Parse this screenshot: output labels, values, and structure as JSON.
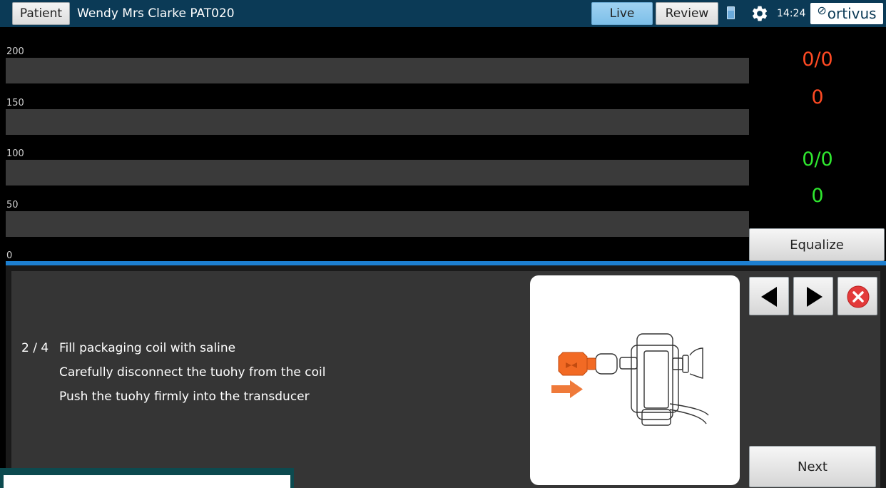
{
  "header": {
    "patient_button": "Patient",
    "patient_name": "Wendy Mrs Clarke PAT020",
    "live_button": "Live",
    "review_button": "Review",
    "clock": "14:24",
    "logo_text": "ortivus",
    "icons": [
      "battery-icon",
      "gear-icon"
    ]
  },
  "chart": {
    "y_ticks": [
      "200",
      "150",
      "100",
      "50",
      "0"
    ]
  },
  "readings": {
    "red_pressure": "0/0",
    "red_value": "0",
    "green_pressure": "0/0",
    "green_value": "0",
    "colors": {
      "red": "#ff4a23",
      "green": "#2fe82f"
    }
  },
  "equalize_button": "Equalize",
  "instructions": {
    "counter": "2 / 4",
    "lines": [
      "Fill packaging coil with saline",
      "Carefully disconnect the tuohy from the coil",
      "Push the tuohy firmly into the transducer"
    ]
  },
  "navigation": {
    "icons": [
      "previous-arrow-icon",
      "next-arrow-icon",
      "close-icon"
    ],
    "next_button": "Next"
  },
  "colors": {
    "header_bg": "#0b3a56",
    "accent": "#1d7fd0",
    "panel_bg": "#353535"
  }
}
